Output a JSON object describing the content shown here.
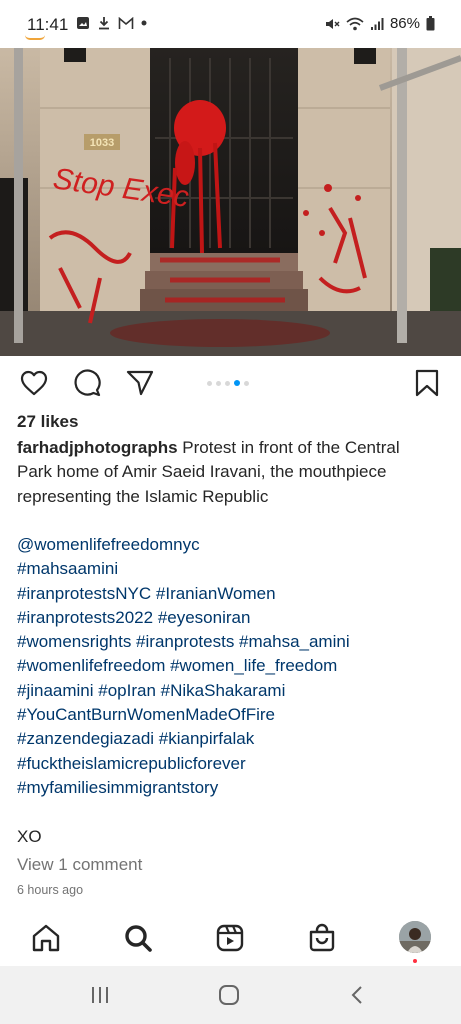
{
  "status_bar": {
    "time": "11:41",
    "left_icons": [
      "gallery-icon",
      "download-icon",
      "gmail-icon",
      "dot-icon"
    ],
    "right_icons": [
      "mute-icon",
      "wifi-icon",
      "signal-icon",
      "battery-icon"
    ],
    "battery": "86%"
  },
  "post": {
    "photo": {
      "description": "building entrance with red paint",
      "wall_text": "Stop Exec",
      "address_plaque": "1033"
    },
    "carousel": {
      "count": 5,
      "active_index": 3
    },
    "likes": "27 likes",
    "username": "farhadjphotographs",
    "caption": " Protest in front of the Central Park home of Amir Saeid Iravani, the mouthpiece representing the Islamic Republic",
    "tag_lines": [
      "@womenlifefreedomnyc",
      "#mahsaamini",
      "#iranprotestsNYC #IranianWomen",
      "#iranprotests2022 #eyesoniran",
      "#womensrights #iranprotests #mahsa_amini",
      "#womenlifefreedom #women_life_freedom",
      "#jinaamini #opIran #NikaShakarami",
      "#YouCantBurnWomenMadeOfFire",
      "#zanzendegiazadi #kianpirfalak",
      "#fucktheislamicrepublicforever",
      "#myfamiliesimmigrantstory"
    ],
    "signoff": "XO",
    "view_comments": "View 1 comment",
    "timestamp": "6 hours ago"
  },
  "colors": {
    "hashtag": "#00376b",
    "carousel_active": "#0095f6",
    "notification_dot": "#ff3040"
  },
  "bottom_nav": [
    "home-icon",
    "search-icon",
    "reels-icon",
    "shop-icon",
    "profile-avatar"
  ],
  "system_nav": [
    "recents-icon",
    "home-button-icon",
    "back-icon"
  ]
}
